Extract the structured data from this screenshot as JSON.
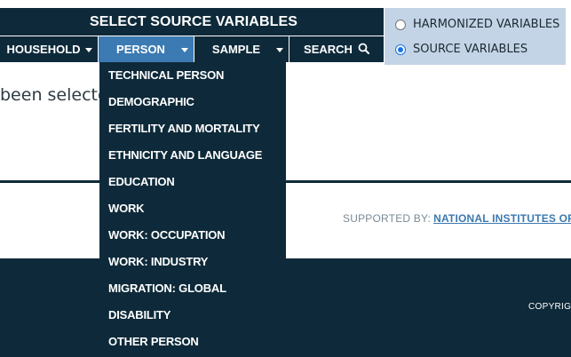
{
  "page": {
    "partial_message": "been selecte",
    "supported_by_label": "SUPPORTED BY:",
    "supported_by_link": "NATIONAL INSTITUTES OF H",
    "copyright": "COPYRIGH"
  },
  "header": {
    "title": "SELECT SOURCE VARIABLES"
  },
  "nav": {
    "household": "HOUSEHOLD",
    "person": "PERSON",
    "sample": "SAMPLE",
    "search": "SEARCH"
  },
  "radio": {
    "harmonized": "HARMONIZED VARIABLES",
    "source": "SOURCE VARIABLES",
    "selected": "source"
  },
  "dropdown": {
    "items": [
      "TECHNICAL PERSON",
      "DEMOGRAPHIC",
      "FERTILITY AND MORTALITY",
      "ETHNICITY AND LANGUAGE",
      "EDUCATION",
      "WORK",
      "WORK: OCCUPATION",
      "WORK: INDUSTRY",
      "MIGRATION: GLOBAL",
      "DISABILITY",
      "OTHER PERSON"
    ]
  },
  "colors": {
    "navy": "#0e2a3a",
    "active_tab": "#3c7ab3",
    "radio_panel": "#c3d4e6",
    "link": "#3c79b0"
  },
  "icons": {
    "search": "search-icon",
    "caret": "chevron-down-icon"
  }
}
